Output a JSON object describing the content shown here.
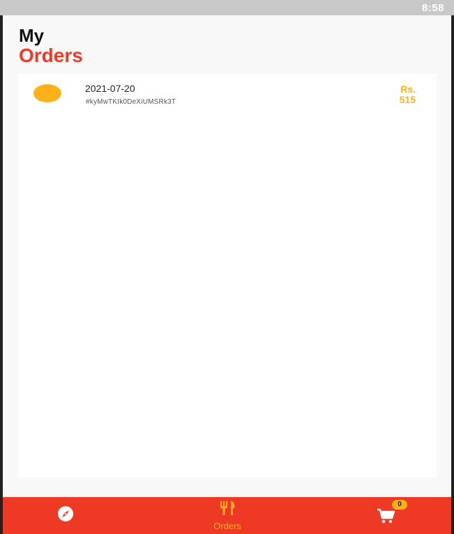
{
  "status_bar": {
    "time": "8:58"
  },
  "header": {
    "title_line1": "My",
    "title_line2": "Orders"
  },
  "orders": [
    {
      "date": "2021-07-20",
      "id": "#kyMwTKIk0DeXiUMSRk3T",
      "currency": "Rs.",
      "amount": "515"
    }
  ],
  "bottom_nav": {
    "items": [
      {
        "name": "explore",
        "icon": "compass-icon",
        "label": ""
      },
      {
        "name": "orders",
        "icon": "fork-knife-icon",
        "label": "Orders"
      },
      {
        "name": "cart",
        "icon": "cart-icon",
        "label": ""
      }
    ],
    "cart_badge": "0"
  },
  "colors": {
    "accent": "#ee3a24",
    "highlight": "#fbb117",
    "status_bar": "#c8c8c8"
  }
}
